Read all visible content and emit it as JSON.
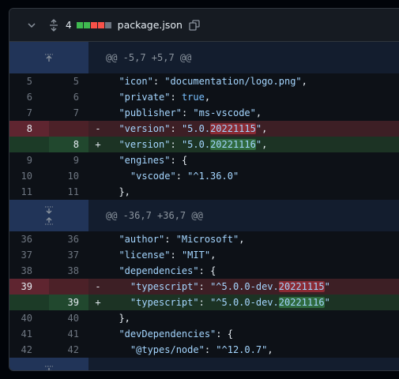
{
  "header": {
    "change_count": "4",
    "file_name": "package.json",
    "diffstat_colors": [
      "#3fb950",
      "#3fb950",
      "#f85149",
      "#f85149",
      "#6e7681"
    ]
  },
  "hunks": [
    "@@ -5,7 +5,7 @@",
    "@@ -36,7 +36,7 @@"
  ],
  "lines": [
    {
      "old": "5",
      "new": "5",
      "type": "ctx",
      "indent": "  ",
      "key": "\"icon\"",
      "sep": ": ",
      "val": "\"documentation/logo.png\"",
      "tail": ","
    },
    {
      "old": "6",
      "new": "6",
      "type": "ctx",
      "indent": "  ",
      "key": "\"private\"",
      "sep": ": ",
      "val": "true",
      "tail": ","
    },
    {
      "old": "7",
      "new": "7",
      "type": "ctx",
      "indent": "  ",
      "key": "\"publisher\"",
      "sep": ": ",
      "val": "\"ms-vscode\"",
      "tail": ","
    },
    {
      "old": "8",
      "new": "",
      "type": "del",
      "indent": "  ",
      "key": "\"version\"",
      "sep": ": ",
      "val_pre": "\"5.0.",
      "val_hl": "20221115",
      "val_post": "\"",
      "tail": ","
    },
    {
      "old": "",
      "new": "8",
      "type": "add",
      "indent": "  ",
      "key": "\"version\"",
      "sep": ": ",
      "val_pre": "\"5.0.",
      "val_hl": "20221116",
      "val_post": "\"",
      "tail": ","
    },
    {
      "old": "9",
      "new": "9",
      "type": "ctx",
      "indent": "  ",
      "key": "\"engines\"",
      "sep": ": ",
      "val": "",
      "tail": "{"
    },
    {
      "old": "10",
      "new": "10",
      "type": "ctx",
      "indent": "    ",
      "key": "\"vscode\"",
      "sep": ": ",
      "val": "\"^1.36.0\"",
      "tail": ""
    },
    {
      "old": "11",
      "new": "11",
      "type": "ctx",
      "indent": "  ",
      "key": "",
      "sep": "",
      "val": "",
      "tail": "},"
    },
    {
      "old": "36",
      "new": "36",
      "type": "ctx",
      "indent": "  ",
      "key": "\"author\"",
      "sep": ": ",
      "val": "\"Microsoft\"",
      "tail": ","
    },
    {
      "old": "37",
      "new": "37",
      "type": "ctx",
      "indent": "  ",
      "key": "\"license\"",
      "sep": ": ",
      "val": "\"MIT\"",
      "tail": ","
    },
    {
      "old": "38",
      "new": "38",
      "type": "ctx",
      "indent": "  ",
      "key": "\"dependencies\"",
      "sep": ": ",
      "val": "",
      "tail": "{"
    },
    {
      "old": "39",
      "new": "",
      "type": "del",
      "indent": "    ",
      "key": "\"typescript\"",
      "sep": ": ",
      "val_pre": "\"^5.0.0-dev.",
      "val_hl": "20221115",
      "val_post": "\"",
      "tail": ""
    },
    {
      "old": "",
      "new": "39",
      "type": "add",
      "indent": "    ",
      "key": "\"typescript\"",
      "sep": ": ",
      "val_pre": "\"^5.0.0-dev.",
      "val_hl": "20221116",
      "val_post": "\"",
      "tail": ""
    },
    {
      "old": "40",
      "new": "40",
      "type": "ctx",
      "indent": "  ",
      "key": "",
      "sep": "",
      "val": "",
      "tail": "},"
    },
    {
      "old": "41",
      "new": "41",
      "type": "ctx",
      "indent": "  ",
      "key": "\"devDependencies\"",
      "sep": ": ",
      "val": "",
      "tail": "{"
    },
    {
      "old": "42",
      "new": "42",
      "type": "ctx",
      "indent": "    ",
      "key": "\"@types/node\"",
      "sep": ": ",
      "val": "\"^12.0.7\"",
      "tail": ","
    }
  ],
  "signs": {
    "del": "-",
    "add": "+",
    "ctx": " "
  }
}
